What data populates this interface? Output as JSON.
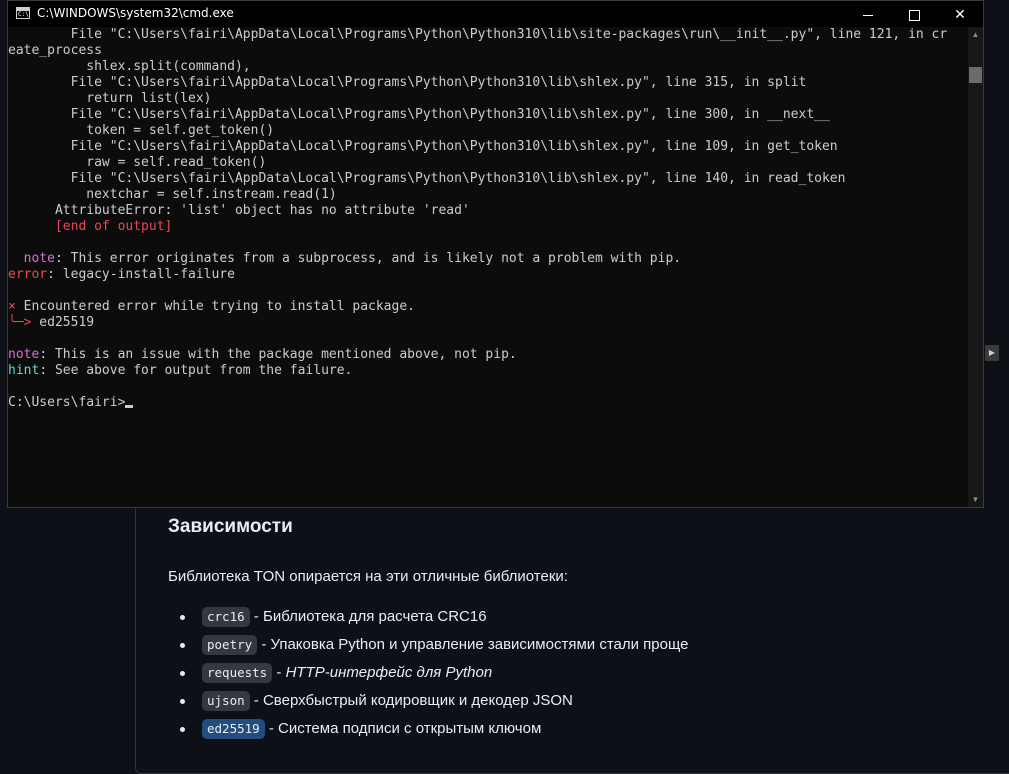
{
  "window": {
    "title": "C:\\WINDOWS\\system32\\cmd.exe",
    "icon_label": "C:\\"
  },
  "console_lines": [
    {
      "text": "        File \"C:\\Users\\fairi\\AppData\\Local\\Programs\\Python\\Python310\\lib\\site-packages\\run\\__init__.py\", line 121, in cr",
      "color": "default"
    },
    {
      "text": "eate_process",
      "color": "default"
    },
    {
      "text": "          shlex.split(command),",
      "color": "default"
    },
    {
      "text": "        File \"C:\\Users\\fairi\\AppData\\Local\\Programs\\Python\\Python310\\lib\\shlex.py\", line 315, in split",
      "color": "default"
    },
    {
      "text": "          return list(lex)",
      "color": "default"
    },
    {
      "text": "        File \"C:\\Users\\fairi\\AppData\\Local\\Programs\\Python\\Python310\\lib\\shlex.py\", line 300, in __next__",
      "color": "default"
    },
    {
      "text": "          token = self.get_token()",
      "color": "default"
    },
    {
      "text": "        File \"C:\\Users\\fairi\\AppData\\Local\\Programs\\Python\\Python310\\lib\\shlex.py\", line 109, in get_token",
      "color": "default"
    },
    {
      "text": "          raw = self.read_token()",
      "color": "default"
    },
    {
      "text": "        File \"C:\\Users\\fairi\\AppData\\Local\\Programs\\Python\\Python310\\lib\\shlex.py\", line 140, in read_token",
      "color": "default"
    },
    {
      "text": "          nextchar = self.instream.read(1)",
      "color": "default"
    },
    {
      "text": "      AttributeError: 'list' object has no attribute 'read'",
      "color": "default"
    },
    {
      "text": "      [end of output]",
      "color": "red"
    },
    {
      "text": "",
      "color": "default"
    },
    {
      "prefix": "  note",
      "prefix_color": "magenta",
      "text": ": This error originates from a subprocess, and is likely not a problem with pip."
    },
    {
      "prefix": "error",
      "prefix_color": "red",
      "text": ": legacy-install-failure"
    },
    {
      "text": "",
      "color": "default"
    },
    {
      "prefix": "×",
      "prefix_color": "red",
      "text": " Encountered error while trying to install package."
    },
    {
      "prefix": "╰─>",
      "prefix_color": "red",
      "text": " ed25519"
    },
    {
      "text": "",
      "color": "default"
    },
    {
      "prefix": "note",
      "prefix_color": "magenta",
      "text": ": This is an issue with the package mentioned above, not pip."
    },
    {
      "prefix": "hint",
      "prefix_color": "cyan",
      "text": ": See above for output from the failure."
    },
    {
      "text": "",
      "color": "default"
    },
    {
      "text": "C:\\Users\\fairi>",
      "color": "default",
      "cursor": true
    }
  ],
  "readme": {
    "heading": "Зависимости",
    "intro": "Библиотека TON опирается на эти отличные библиотеки:",
    "items": [
      {
        "code": "crc16",
        "desc": " - Библиотека для расчета CRC16",
        "italic": false,
        "selected": false
      },
      {
        "code": "poetry",
        "desc": " - Упаковка Python и управление зависимостями стали проще",
        "italic": false,
        "selected": false
      },
      {
        "code": "requests",
        "desc": " - ",
        "desc_italic": "HTTP-интерфейс для Python",
        "italic": true,
        "selected": false
      },
      {
        "code": "ujson",
        "desc": " - Сверхбыстрый кодировщик и декодер JSON",
        "italic": false,
        "selected": false
      },
      {
        "code": "ed25519",
        "desc": " - Система подписи с открытым ключом",
        "italic": false,
        "selected": true
      }
    ]
  },
  "colors": {
    "console_bg": "#0c0c0c",
    "console_fg": "#cccccc",
    "red": "#e74856",
    "magenta": "#d670d6",
    "cyan": "#61d6d6",
    "page_bg": "#0d1117",
    "code_bg": "#343941",
    "selection": "#234d7f"
  },
  "icons": {
    "minimize": "minimize-icon",
    "maximize": "maximize-icon",
    "close": "close-icon",
    "scroll_up": "triangle-up-icon",
    "scroll_down": "triangle-down-icon",
    "expand": "triangle-right-icon"
  }
}
